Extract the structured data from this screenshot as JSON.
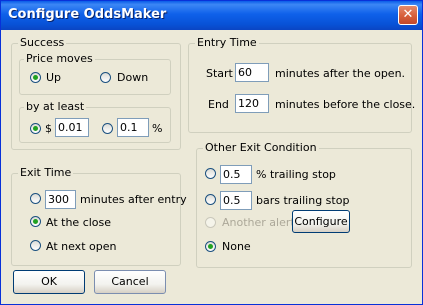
{
  "window": {
    "title": "Configure OddsMaker",
    "close": "✕"
  },
  "success": {
    "label": "Success",
    "price_moves": {
      "label": "Price moves",
      "up": "Up",
      "down": "Down",
      "selected": "Up"
    },
    "by_at_least": {
      "label": "by at least",
      "dollar_label": "$",
      "dollar_value": "0.01",
      "percent_value": "0.1",
      "percent_label": "%",
      "selected": "$"
    }
  },
  "entry_time": {
    "label": "Entry Time",
    "start_label": "Start",
    "start_value": "60",
    "start_suffix": "minutes after the open.",
    "end_label": "End",
    "end_value": "120",
    "end_suffix": "minutes before the close."
  },
  "exit_time": {
    "label": "Exit Time",
    "minutes_value": "300",
    "minutes_suffix": "minutes after entry",
    "at_close": "At the close",
    "at_next_open": "At next open",
    "selected": "At the close"
  },
  "other_exit": {
    "label": "Other Exit Condition",
    "pct_value": "0.5",
    "pct_suffix": "% trailing stop",
    "bars_value": "0.5",
    "bars_suffix": "bars trailing stop",
    "another_alert": "Another alert",
    "configure": "Configure",
    "none": "None",
    "selected": "None"
  },
  "footer": {
    "ok": "OK",
    "cancel": "Cancel"
  }
}
